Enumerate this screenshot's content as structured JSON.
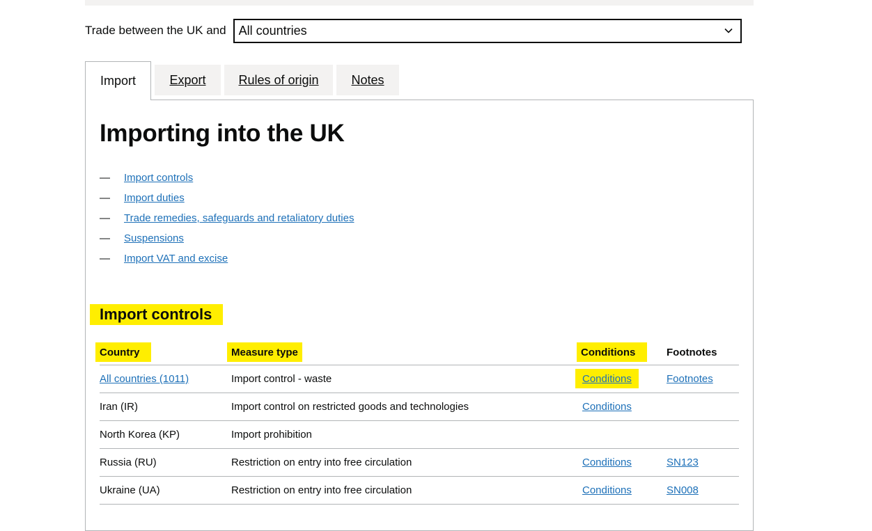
{
  "trade": {
    "label": "Trade between the UK and",
    "selected_country": "All countries"
  },
  "tabs": [
    {
      "label": "Import",
      "active": true
    },
    {
      "label": "Export",
      "active": false
    },
    {
      "label": "Rules of origin",
      "active": false
    },
    {
      "label": "Notes",
      "active": false
    }
  ],
  "page_title": "Importing into the UK",
  "contents": [
    {
      "dash": "—",
      "label": "Import controls"
    },
    {
      "dash": "—",
      "label": "Import duties"
    },
    {
      "dash": "—",
      "label": "Trade remedies, safeguards and retaliatory duties"
    },
    {
      "dash": "—",
      "label": "Suspensions"
    },
    {
      "dash": "—",
      "label": "Import VAT and excise"
    }
  ],
  "import_controls": {
    "heading": "Import controls",
    "columns": [
      "Country",
      "Measure type",
      "Conditions",
      "Footnotes"
    ],
    "rows": [
      {
        "country": "All countries (1011)",
        "country_is_link": true,
        "measure": "Import control - waste",
        "conditions": "Conditions",
        "footnotes": "Footnotes"
      },
      {
        "country": "Iran (IR)",
        "country_is_link": false,
        "measure": "Import control on restricted goods and technologies",
        "conditions": "Conditions",
        "footnotes": ""
      },
      {
        "country": "North Korea (KP)",
        "country_is_link": false,
        "measure": "Import prohibition",
        "conditions": "",
        "footnotes": ""
      },
      {
        "country": "Russia (RU)",
        "country_is_link": false,
        "measure": "Restriction on entry into free circulation",
        "conditions": "Conditions",
        "footnotes": "SN123"
      },
      {
        "country": "Ukraine (UA)",
        "country_is_link": false,
        "measure": "Restriction on entry into free circulation",
        "conditions": "Conditions",
        "footnotes": "SN008"
      }
    ]
  },
  "colors": {
    "link": "#1d70b8",
    "highlight": "#ffee00",
    "tab_inactive": "#f3f2f1",
    "border": "#b1b4b6",
    "text": "#0b0c0c"
  }
}
